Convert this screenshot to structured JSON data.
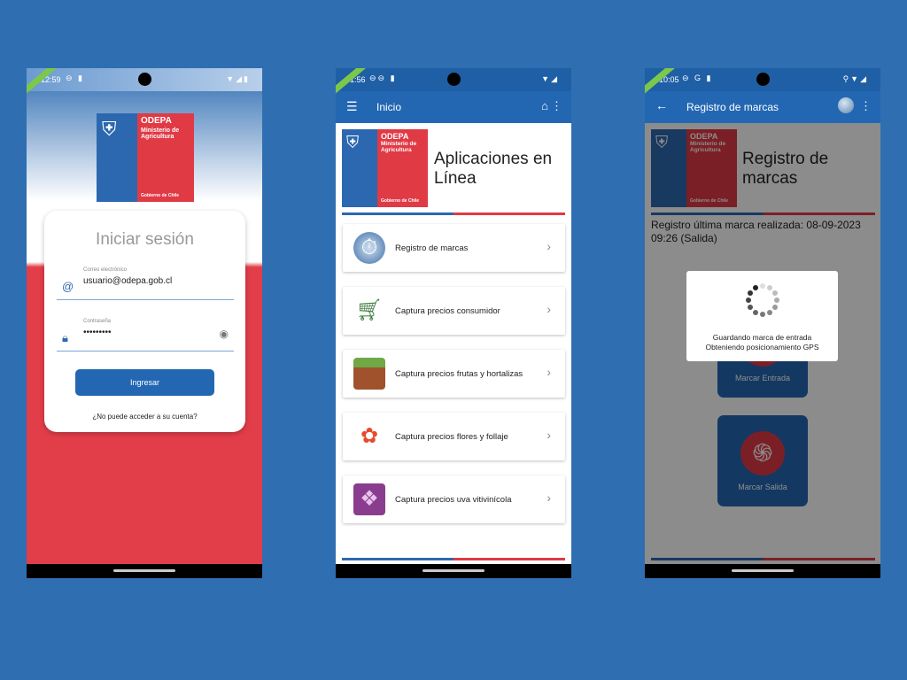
{
  "login": {
    "time": "12:59",
    "logo": {
      "org": "ODEPA",
      "ministry": "Ministerio de Agricultura",
      "gov": "Gobierno de Chile"
    },
    "title": "Iniciar sesión",
    "email": {
      "label": "Correo electrónico",
      "value": "usuario@odepa.gob.cl"
    },
    "password": {
      "label": "Contraseña",
      "value": "•••••••••"
    },
    "submit_label": "Ingresar",
    "forgot_label": "¿No puede acceder a su cuenta?"
  },
  "home": {
    "time": "1:56",
    "appbar_title": "Inicio",
    "logo": {
      "org": "ODEPA",
      "ministry": "Ministerio de Agricultura",
      "gov": "Gobierno de Chile"
    },
    "header_title": "Aplicaciones en Línea",
    "items": [
      {
        "label": "Registro de marcas",
        "icon": "clock-icon"
      },
      {
        "label": "Captura precios consumidor",
        "icon": "cart-icon"
      },
      {
        "label": "Captura precios frutas y hortalizas",
        "icon": "crate-icon"
      },
      {
        "label": "Captura precios flores y follaje",
        "icon": "flower-icon"
      },
      {
        "label": "Captura precios uva vitivinícola",
        "icon": "grapes-icon"
      }
    ]
  },
  "registro": {
    "time": "10:05",
    "appbar_title": "Registro de marcas",
    "logo": {
      "org": "ODEPA",
      "ministry": "Ministerio de Agricultura",
      "gov": "Gobierno de Chile"
    },
    "header_title": "Registro de marcas",
    "last_mark": "Registro última marca realizada: 08-09-2023 09:26 (Salida)",
    "entrada_label": "Marcar Entrada",
    "salida_label": "Marcar Salida",
    "dialog": {
      "line1": "Guardando marca de entrada",
      "line2": "Obteniendo posicionamiento GPS"
    }
  },
  "colors": {
    "background": "#2f6fb1",
    "primary": "#2367b3",
    "red": "#e03a45"
  }
}
